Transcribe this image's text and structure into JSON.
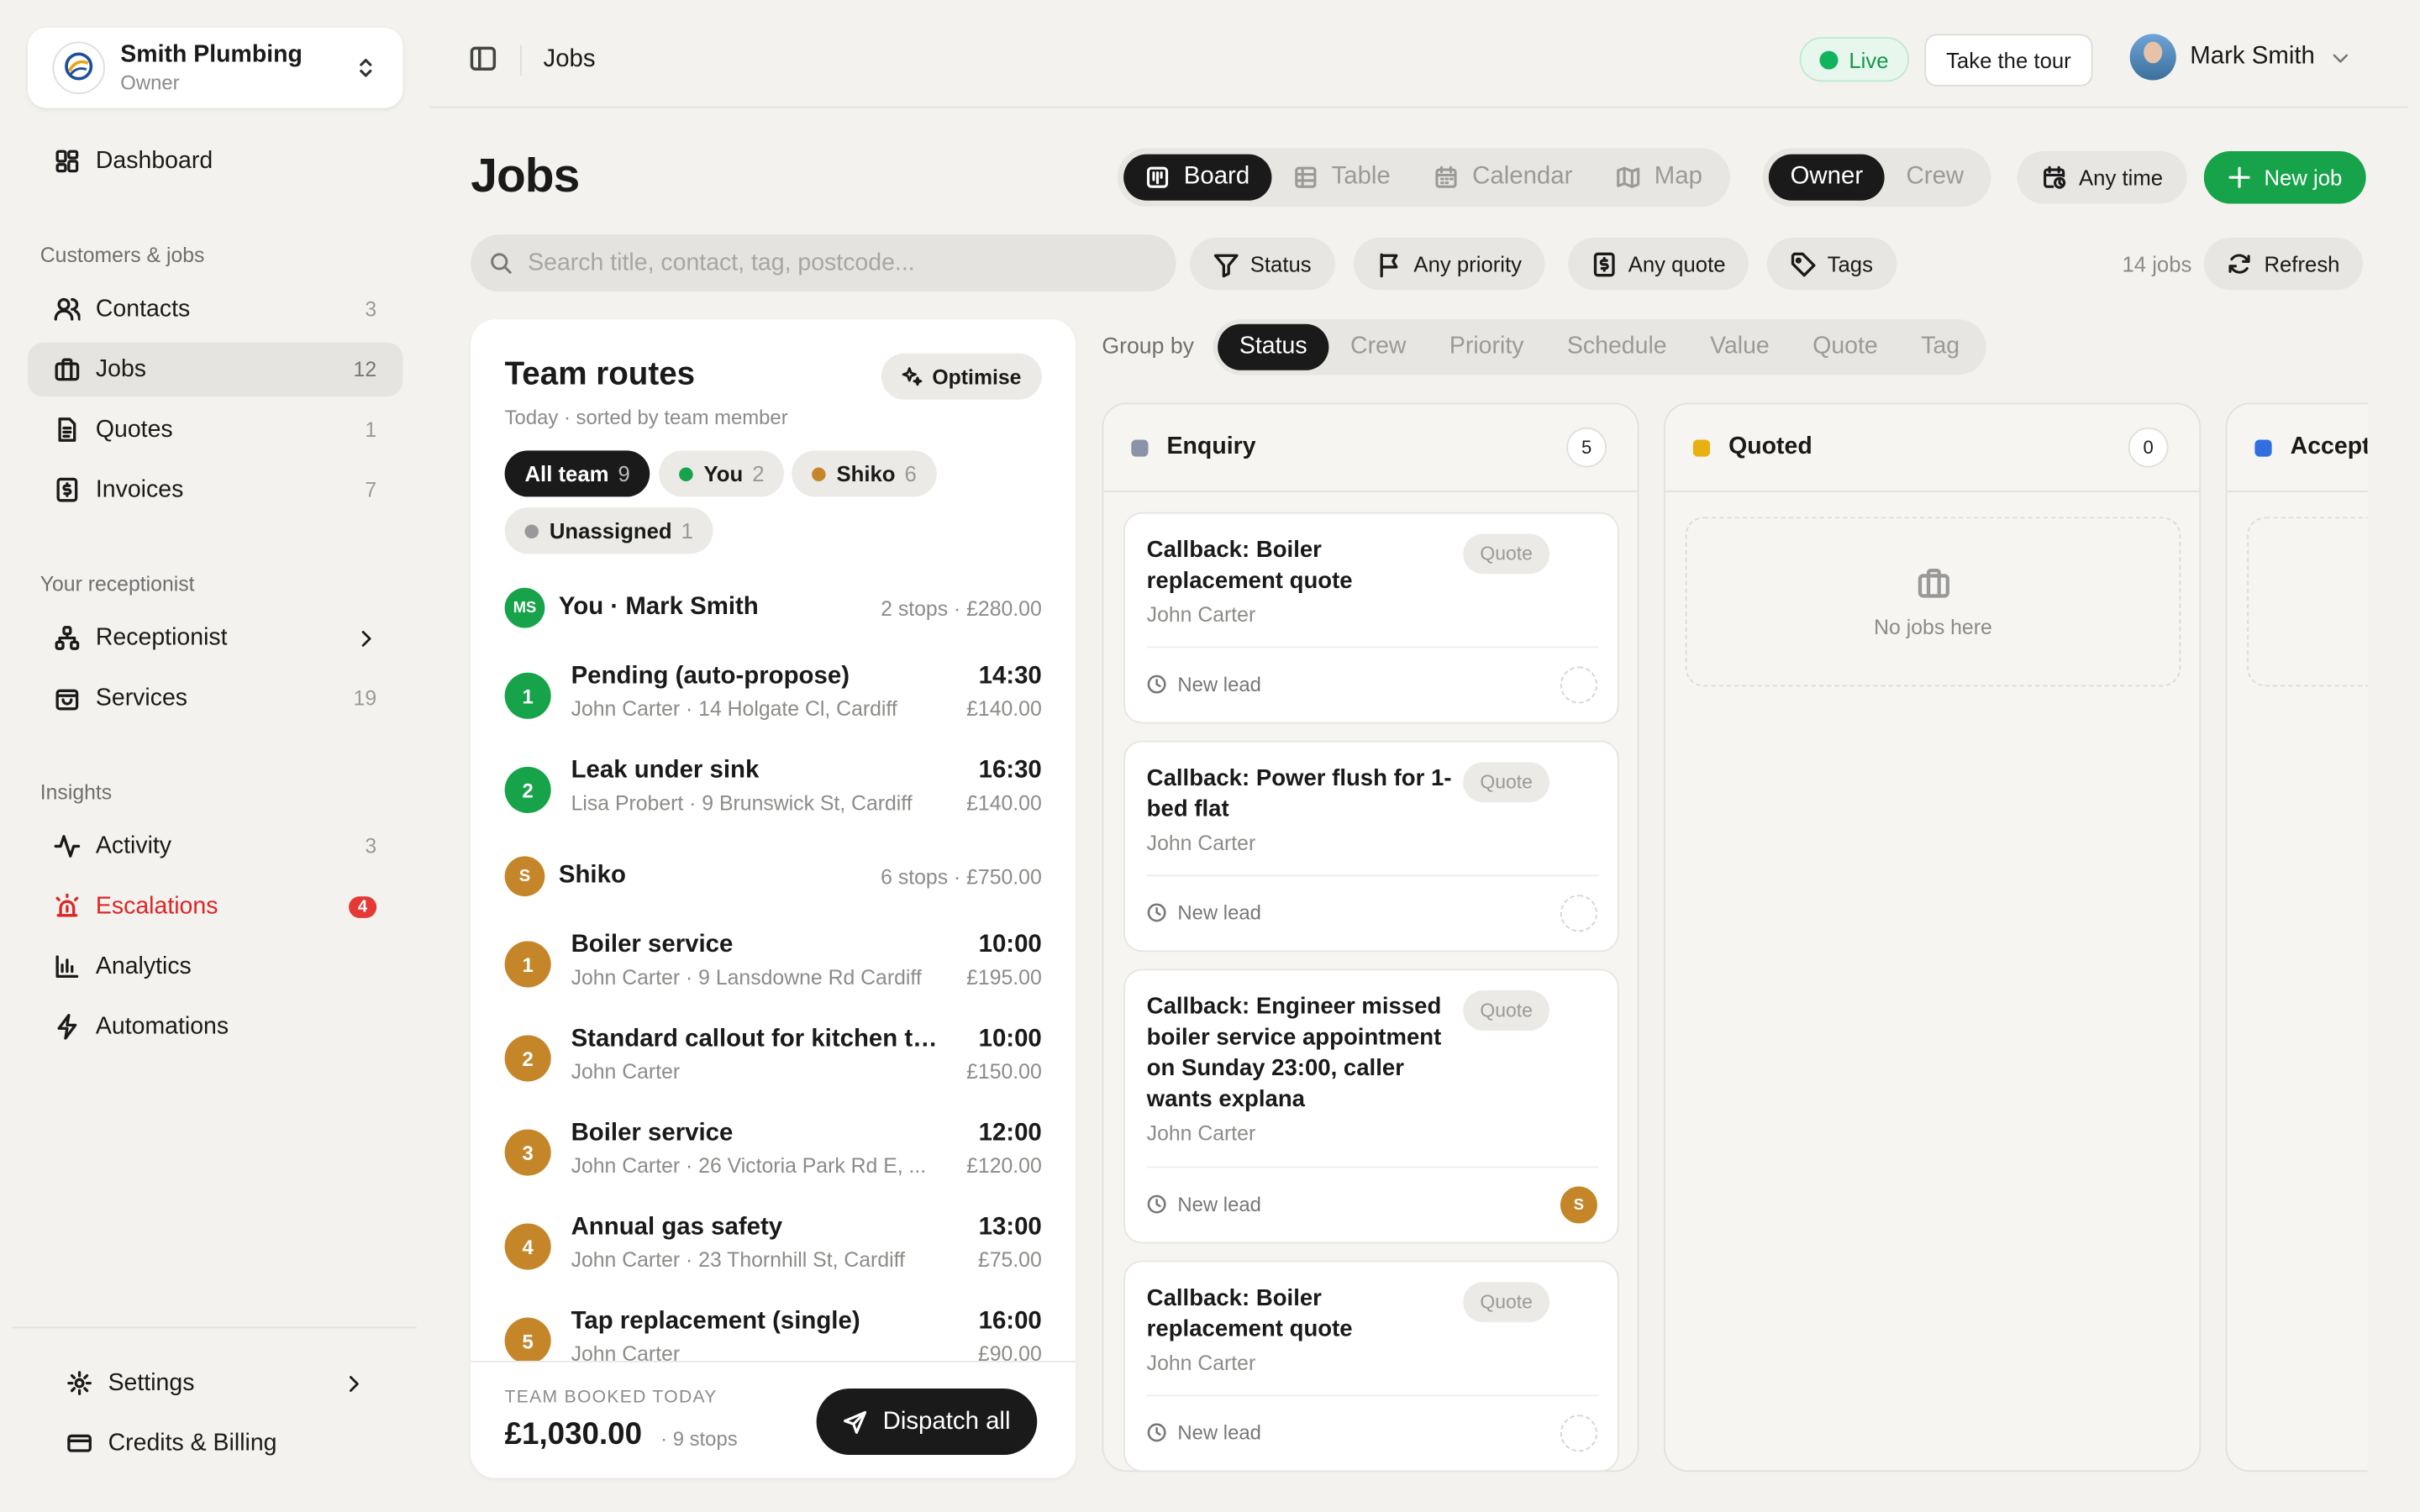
{
  "company": {
    "name": "Smith Plumbing",
    "role": "Owner"
  },
  "sidebar": {
    "dashboard": "Dashboard",
    "section_customers": "Customers & jobs",
    "contacts": {
      "label": "Contacts",
      "count": "3"
    },
    "jobs": {
      "label": "Jobs",
      "count": "12"
    },
    "quotes": {
      "label": "Quotes",
      "count": "1"
    },
    "invoices": {
      "label": "Invoices",
      "count": "7"
    },
    "section_receptionist": "Your receptionist",
    "receptionist": "Receptionist",
    "services": {
      "label": "Services",
      "count": "19"
    },
    "section_insights": "Insights",
    "activity": {
      "label": "Activity",
      "count": "3"
    },
    "escalations": {
      "label": "Escalations",
      "count": "4"
    },
    "analytics": "Analytics",
    "automations": "Automations",
    "settings": "Settings",
    "billing": "Credits & Billing"
  },
  "topbar": {
    "breadcrumb": "Jobs",
    "live": "Live",
    "tour": "Take the tour",
    "user": "Mark Smith"
  },
  "page": {
    "title": "Jobs",
    "views": [
      "Board",
      "Table",
      "Calendar",
      "Map"
    ],
    "active_view": "Board",
    "roles": [
      "Owner",
      "Crew"
    ],
    "active_role": "Owner",
    "any_time": "Any time",
    "new_job": "New job"
  },
  "filters": {
    "search_placeholder": "Search title, contact, tag, postcode...",
    "status": "Status",
    "priority": "Any priority",
    "quote": "Any quote",
    "tags": "Tags",
    "job_count": "14 jobs",
    "refresh": "Refresh"
  },
  "routes": {
    "title": "Team routes",
    "subtitle": "Today · sorted by team member",
    "optimise": "Optimise",
    "pills": [
      {
        "label": "All team",
        "count": "9"
      },
      {
        "label": "You",
        "count": "2"
      },
      {
        "label": "Shiko",
        "count": "6"
      },
      {
        "label": "Unassigned",
        "count": "1"
      }
    ],
    "members": [
      {
        "initials": "MS",
        "name": "You · Mark Smith",
        "summary": "2 stops · £280.00",
        "color": "#16a34a"
      },
      {
        "initials": "S",
        "name": "Shiko",
        "summary": "6 stops · £750.00",
        "color": "#c5862a"
      }
    ],
    "stops_you": [
      {
        "n": "1",
        "title": "Pending (auto-propose)",
        "detail": "John Carter · 14 Holgate Cl, Cardiff",
        "time": "14:30",
        "price": "£140.00"
      },
      {
        "n": "2",
        "title": "Leak under sink",
        "detail": "Lisa Probert · 9 Brunswick St, Cardiff",
        "time": "16:30",
        "price": "£140.00"
      }
    ],
    "stops_shiko": [
      {
        "n": "1",
        "title": "Boiler service",
        "detail": "John Carter · 9 Lansdowne Rd Cardiff",
        "time": "10:00",
        "price": "£195.00"
      },
      {
        "n": "2",
        "title": "Standard callout for kitchen ta...",
        "detail": "John Carter",
        "time": "10:00",
        "price": "£150.00"
      },
      {
        "n": "3",
        "title": "Boiler service",
        "detail": "John Carter · 26 Victoria Park Rd E, ...",
        "time": "12:00",
        "price": "£120.00"
      },
      {
        "n": "4",
        "title": "Annual gas safety",
        "detail": "John Carter · 23 Thornhill St, Cardiff",
        "time": "13:00",
        "price": "£75.00"
      },
      {
        "n": "5",
        "title": "Tap replacement (single)",
        "detail": "John Carter",
        "time": "16:00",
        "price": "£90.00"
      }
    ],
    "footer": {
      "label": "TEAM BOOKED TODAY",
      "amount": "£1,030.00",
      "stops": "· 9 stops",
      "dispatch": "Dispatch all"
    }
  },
  "groupby": {
    "label": "Group by",
    "options": [
      "Status",
      "Crew",
      "Priority",
      "Schedule",
      "Value",
      "Quote",
      "Tag"
    ],
    "active": "Status"
  },
  "board": {
    "columns": [
      {
        "name": "Enquiry",
        "count": "5",
        "color": "#8b93a8"
      },
      {
        "name": "Quoted",
        "count": "0",
        "color": "#e8b010"
      },
      {
        "name": "Accepted",
        "count": "",
        "color": "#2f6fe0"
      }
    ],
    "enquiry_cards": [
      {
        "title": "Callback: Boiler replacement quote",
        "badge": "Quote",
        "contact": "John Carter",
        "status": "New lead",
        "assignee": ""
      },
      {
        "title": "Callback: Power flush for 1-bed flat",
        "badge": "Quote",
        "contact": "John Carter",
        "status": "New lead",
        "assignee": ""
      },
      {
        "title": "Callback: Engineer missed boiler service appointment on Sunday 23:00, caller wants explana",
        "badge": "Quote",
        "contact": "John Carter",
        "status": "New lead",
        "assignee": "S"
      },
      {
        "title": "Callback: Boiler replacement quote",
        "badge": "Quote",
        "contact": "John Carter",
        "status": "New lead",
        "assignee": ""
      }
    ],
    "empty_text": "No jobs here"
  }
}
